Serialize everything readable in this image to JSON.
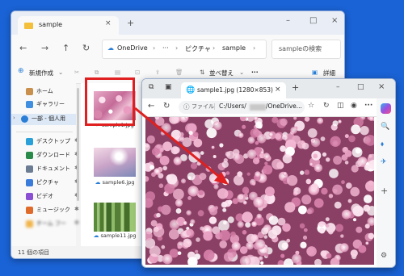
{
  "explorer": {
    "tab_title": "sample",
    "tab_close": "×",
    "new_tab": "+",
    "window_controls": [
      "–",
      "□",
      "×"
    ],
    "nav": [
      "←",
      "→",
      "↑",
      "↻"
    ],
    "path": [
      "OneDrive",
      "›",
      "···",
      "›",
      "ピクチャ",
      "›",
      "sample",
      "›"
    ],
    "search_placeholder": "sampleの検索",
    "toolbar": {
      "new_label": "新規作成",
      "new_chevron": "⌄",
      "sort_label": "並べ替え",
      "view_chevron": "⌄",
      "more": "···",
      "details_label": "詳細"
    },
    "sidebar": {
      "home": "ホーム",
      "gallery": "ギャラリー",
      "onedrive": "一部 - 個人用",
      "desktop": "デスクトップ",
      "downloads": "ダウンロード",
      "documents": "ドキュメント",
      "pictures": "ピクチャ",
      "videos": "ビデオ",
      "music": "ミュージック",
      "last": "チーム フー",
      "pin": "✱"
    },
    "files": [
      {
        "name": "sample1.jpg",
        "status": "✓"
      },
      {
        "name": "sample6.jpg",
        "status": "☁"
      },
      {
        "name": "sample11.jpg",
        "status": "☁"
      }
    ],
    "status_text": "11 個の項目"
  },
  "browser": {
    "tab_title": "sample1.jpg (1280×853)",
    "tab_close": "×",
    "new_tab": "+",
    "window_controls": [
      "–",
      "□",
      "×"
    ],
    "nav": [
      "←",
      "↻"
    ],
    "url_prefix": "ファイル",
    "url_text": "C:/Users/",
    "url_tail": "/OneDrive...",
    "side_icons": [
      "🔍",
      "⬧",
      "✈",
      "+",
      "⚙"
    ]
  },
  "colors": {
    "desktop": "#1a63d6",
    "callout": "#e02020"
  }
}
